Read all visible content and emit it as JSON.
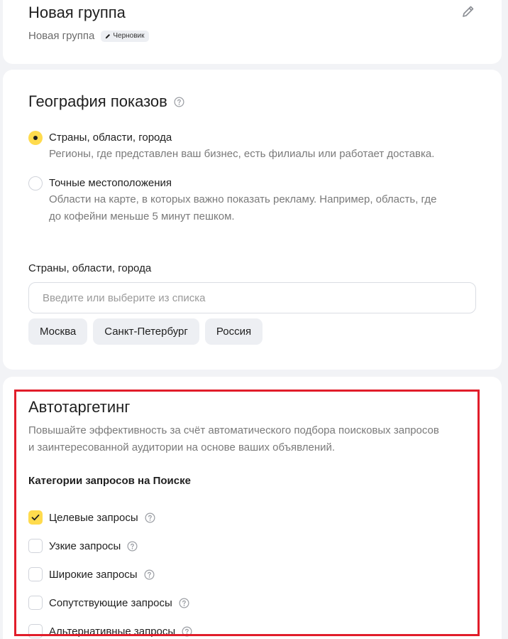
{
  "group": {
    "title": "Новая группа",
    "subtitle": "Новая группа",
    "badge": "Черновик"
  },
  "geo": {
    "title": "География показов",
    "options": [
      {
        "label": "Страны, области, города",
        "description": "Регионы, где представлен ваш бизнес, есть филиалы или работает доставка.",
        "selected": true
      },
      {
        "label": "Точные местоположения",
        "description_line1": "Области на карте, в которых важно показать рекламу. Например, область, где",
        "description_line2": "до кофейни меньше 5 минут пешком.",
        "selected": false
      }
    ],
    "field_label": "Страны, области, города",
    "input_placeholder": "Введите или выберите из списка",
    "input_value": "",
    "chips": [
      "Москва",
      "Санкт-Петербург",
      "Россия"
    ]
  },
  "auto": {
    "title": "Автотаргетинг",
    "description_line1": "Повышайте эффективность за счёт автоматического подбора поисковых запросов",
    "description_line2": "и заинтересованной аудитории на основе ваших объявлений.",
    "categories_title": "Категории запросов на Поиске",
    "categories": [
      {
        "label": "Целевые запросы",
        "checked": true
      },
      {
        "label": "Узкие запросы",
        "checked": false
      },
      {
        "label": "Широкие запросы",
        "checked": false
      },
      {
        "label": "Сопутствующие запросы",
        "checked": false
      },
      {
        "label": "Альтернативные запросы",
        "checked": false
      }
    ]
  },
  "colors": {
    "accent": "#ffdb4d",
    "highlight": "#e11d2a",
    "background": "#f2f3f6",
    "chip": "#edeff3"
  },
  "icons": {
    "edit": "pencil-icon",
    "badge": "pencil-small-icon",
    "help": "question-circle-icon",
    "check": "check-icon"
  }
}
